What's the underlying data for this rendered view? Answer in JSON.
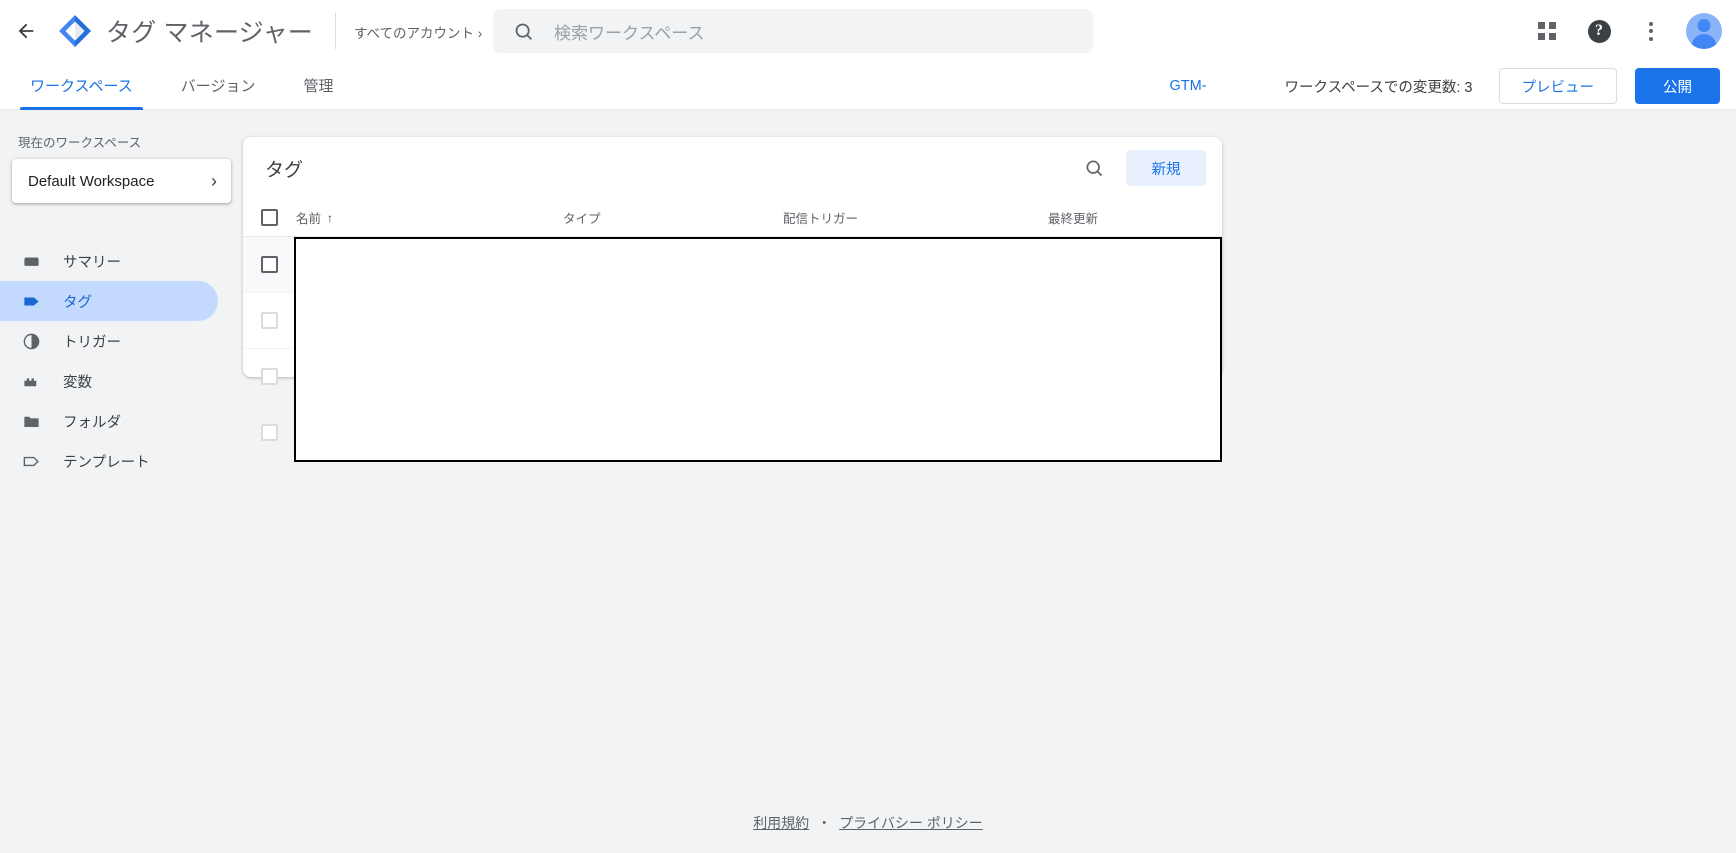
{
  "topbar": {
    "back_icon": "arrow-left-icon",
    "logo_icon": "tag-manager-logo-icon",
    "product_title": "タグ マネージャー",
    "account_path": "すべてのアカウント ›",
    "account_caret_icon": "chevron-down-icon",
    "search": {
      "icon": "search-icon",
      "placeholder": "検索ワークスペース",
      "value": ""
    },
    "actions": {
      "apps_icon": "apps-grid-icon",
      "help_icon": "help-circle-icon",
      "help_glyph": "?",
      "more_icon": "more-vert-icon",
      "avatar_icon": "account-avatar-icon"
    }
  },
  "tabbar": {
    "tabs": [
      {
        "label": "ワークスペース",
        "active": true
      },
      {
        "label": "バージョン",
        "active": false
      },
      {
        "label": "管理",
        "active": false
      }
    ],
    "container_id": "GTM-",
    "changes_label": "ワークスペースでの変更数: 3",
    "preview_label": "プレビュー",
    "publish_label": "公開"
  },
  "sidebar": {
    "current_workspace_label": "現在のワークスペース",
    "workspace_name": "Default Workspace",
    "workspace_chevron_icon": "chevron-right-icon",
    "items": [
      {
        "label": "サマリー",
        "icon": "summary-icon",
        "active": false
      },
      {
        "label": "タグ",
        "icon": "tag-icon",
        "active": true
      },
      {
        "label": "トリガー",
        "icon": "trigger-icon",
        "active": false
      },
      {
        "label": "変数",
        "icon": "variable-icon",
        "active": false
      },
      {
        "label": "フォルダ",
        "icon": "folder-icon",
        "active": false
      },
      {
        "label": "テンプレート",
        "icon": "template-icon",
        "active": false
      }
    ]
  },
  "main": {
    "card_title": "タグ",
    "search_icon": "search-icon",
    "new_button_label": "新規",
    "columns": [
      {
        "key": "name",
        "label": "名前",
        "sort": "↑"
      },
      {
        "key": "type",
        "label": "タイプ"
      },
      {
        "key": "trigger",
        "label": "配信トリガー"
      },
      {
        "key": "updated",
        "label": "最終更新"
      }
    ],
    "select_all_checkbox": false,
    "rows": [
      {
        "checked": false,
        "hovered": true,
        "name": "",
        "type": "",
        "trigger": "",
        "updated": ""
      },
      {
        "checked": false,
        "hovered": false,
        "name": "",
        "type": "",
        "trigger": "",
        "updated": ""
      },
      {
        "checked": false,
        "hovered": false,
        "name": "",
        "type": "",
        "trigger": "",
        "updated": ""
      },
      {
        "checked": false,
        "hovered": false,
        "name": "",
        "type": "",
        "trigger": "",
        "updated": ""
      }
    ],
    "redaction_overlay": true
  },
  "footer": {
    "terms_label": "利用規約",
    "separator": "・",
    "privacy_label": "プライバシー ポリシー"
  },
  "colors": {
    "accent_blue": "#1a73e8",
    "nav_active_bg": "#c3dafe",
    "nav_active_fg": "#1967d2",
    "page_bg": "#f1f3f4",
    "card_bg": "#ffffff",
    "text_primary": "#3c4043",
    "text_secondary": "#5f6368",
    "new_button_bg": "#e8f0fe",
    "redaction_border": "#000000"
  }
}
